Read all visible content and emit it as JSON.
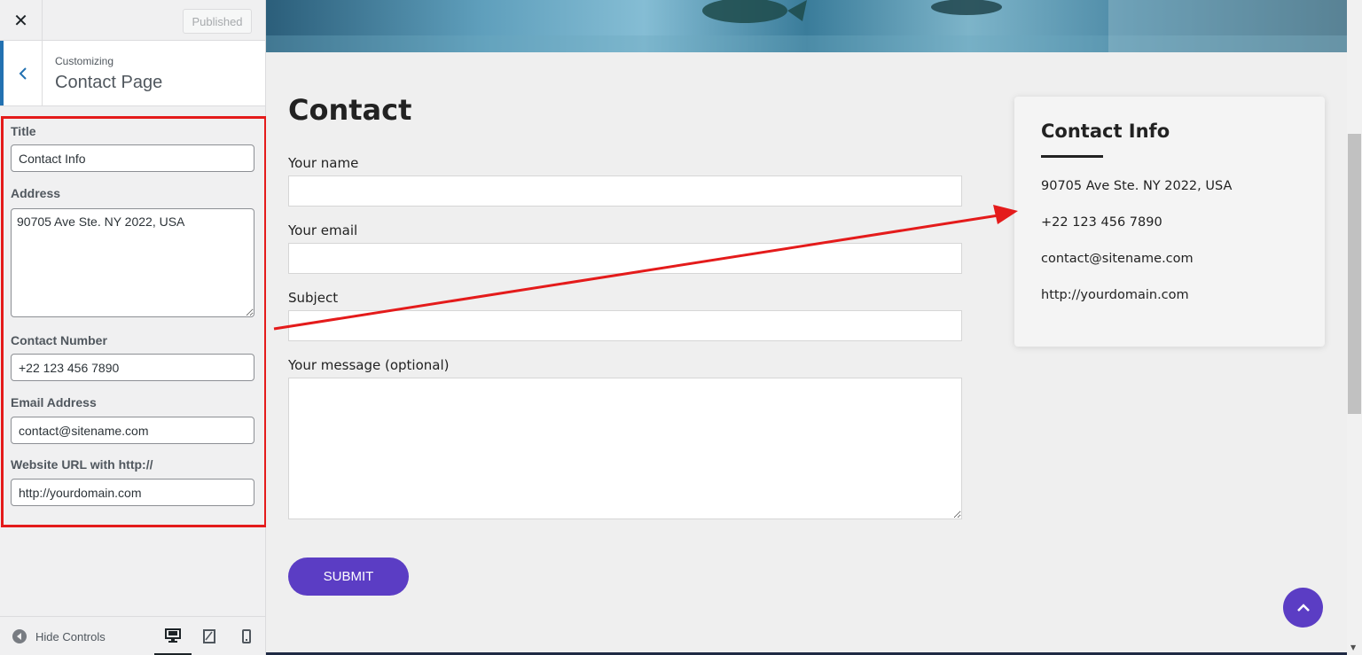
{
  "header": {
    "close_icon": "close-icon",
    "publish_label": "Published"
  },
  "section": {
    "customizing_label": "Customizing",
    "title": "Contact Page"
  },
  "controls": {
    "title_label": "Title",
    "title_value": "Contact Info",
    "address_label": "Address",
    "address_value": "90705 Ave Ste. NY 2022, USA",
    "contact_label": "Contact Number",
    "contact_value": "+22 123 456 7890",
    "email_label": "Email Address",
    "email_value": "contact@sitename.com",
    "website_label": "Website URL with http://",
    "website_value": "http://yourdomain.com"
  },
  "footer": {
    "hide_controls_label": "Hide Controls",
    "devices": [
      "desktop",
      "tablet",
      "mobile"
    ],
    "active_device": "desktop"
  },
  "preview": {
    "page_heading": "Contact",
    "form": {
      "name_label": "Your name",
      "email_label": "Your email",
      "subject_label": "Subject",
      "message_label": "Your message (optional)",
      "submit_label": "SUBMIT"
    },
    "info": {
      "title": "Contact Info",
      "address": "90705 Ave Ste. NY 2022, USA",
      "phone": "+22 123 456 7890",
      "email": "contact@sitename.com",
      "website": "http://yourdomain.com"
    }
  },
  "colors": {
    "accent": "#5b3dc4",
    "highlight": "#e41b1b",
    "wp_blue": "#2271b1"
  }
}
